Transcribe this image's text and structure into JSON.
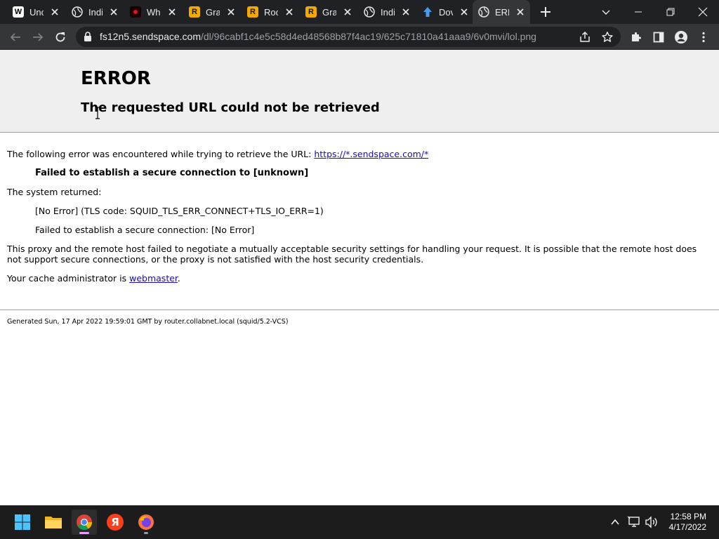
{
  "browser": {
    "tabs": [
      {
        "title": "Unc",
        "favicon": "wikipedia-icon"
      },
      {
        "title": "Indi",
        "favicon": "globe-icon"
      },
      {
        "title": "Wh",
        "favicon": "dark-site-icon"
      },
      {
        "title": "Gra",
        "favicon": "rockstar-icon"
      },
      {
        "title": "Roc",
        "favicon": "rockstar-icon"
      },
      {
        "title": "Gra",
        "favicon": "rockstar-icon"
      },
      {
        "title": "Indi",
        "favicon": "globe-icon"
      },
      {
        "title": "Dov",
        "favicon": "upload-arrow-icon"
      },
      {
        "title": "ERR",
        "favicon": "globe-icon",
        "active": true
      }
    ],
    "url_host": "fs12n5.sendspace.com",
    "url_path": "/dl/96cabf1c4e5c58d4ed48568b87f4ac19/625c71810a41aaa9/6v0mvi/lol.png",
    "colors": {
      "tabstrip": "#202124",
      "toolbar": "#35363a",
      "omnibox": "#202124"
    }
  },
  "page": {
    "title": "ERROR",
    "subtitle": "The requested URL could not be retrieved",
    "intro_text": "The following error was encountered while trying to retrieve the URL: ",
    "intro_link": "https://*.sendspace.com/*",
    "error_detail": "Failed to establish a secure connection to [unknown]",
    "system_returned": "The system returned:",
    "tls_code": "[No Error] (TLS code: SQUID_TLS_ERR_CONNECT+TLS_IO_ERR=1)",
    "secure_fail": "Failed to establish a secure connection: [No Error]",
    "explanation": "This proxy and the remote host failed to negotiate a mutually acceptable security settings for handling your request. It is possible that the remote host does not support secure connections, or the proxy is not satisfied with the host security credentials.",
    "admin_prefix": "Your cache administrator is ",
    "admin_link": "webmaster",
    "admin_suffix": ".",
    "footer": "Generated Sun, 17 Apr 2022 19:59:01 GMT by router.collabnet.local (squid/5.2-VCS)",
    "colors": {
      "header_bg": "#efefef",
      "link": "#1a0dab"
    }
  },
  "taskbar": {
    "apps": [
      "windows-start-icon",
      "file-explorer-icon",
      "chrome-icon",
      "yandex-icon",
      "firefox-icon"
    ],
    "yandex_glyph": "Я",
    "time": "12:58 PM",
    "date": "4/17/2022"
  }
}
